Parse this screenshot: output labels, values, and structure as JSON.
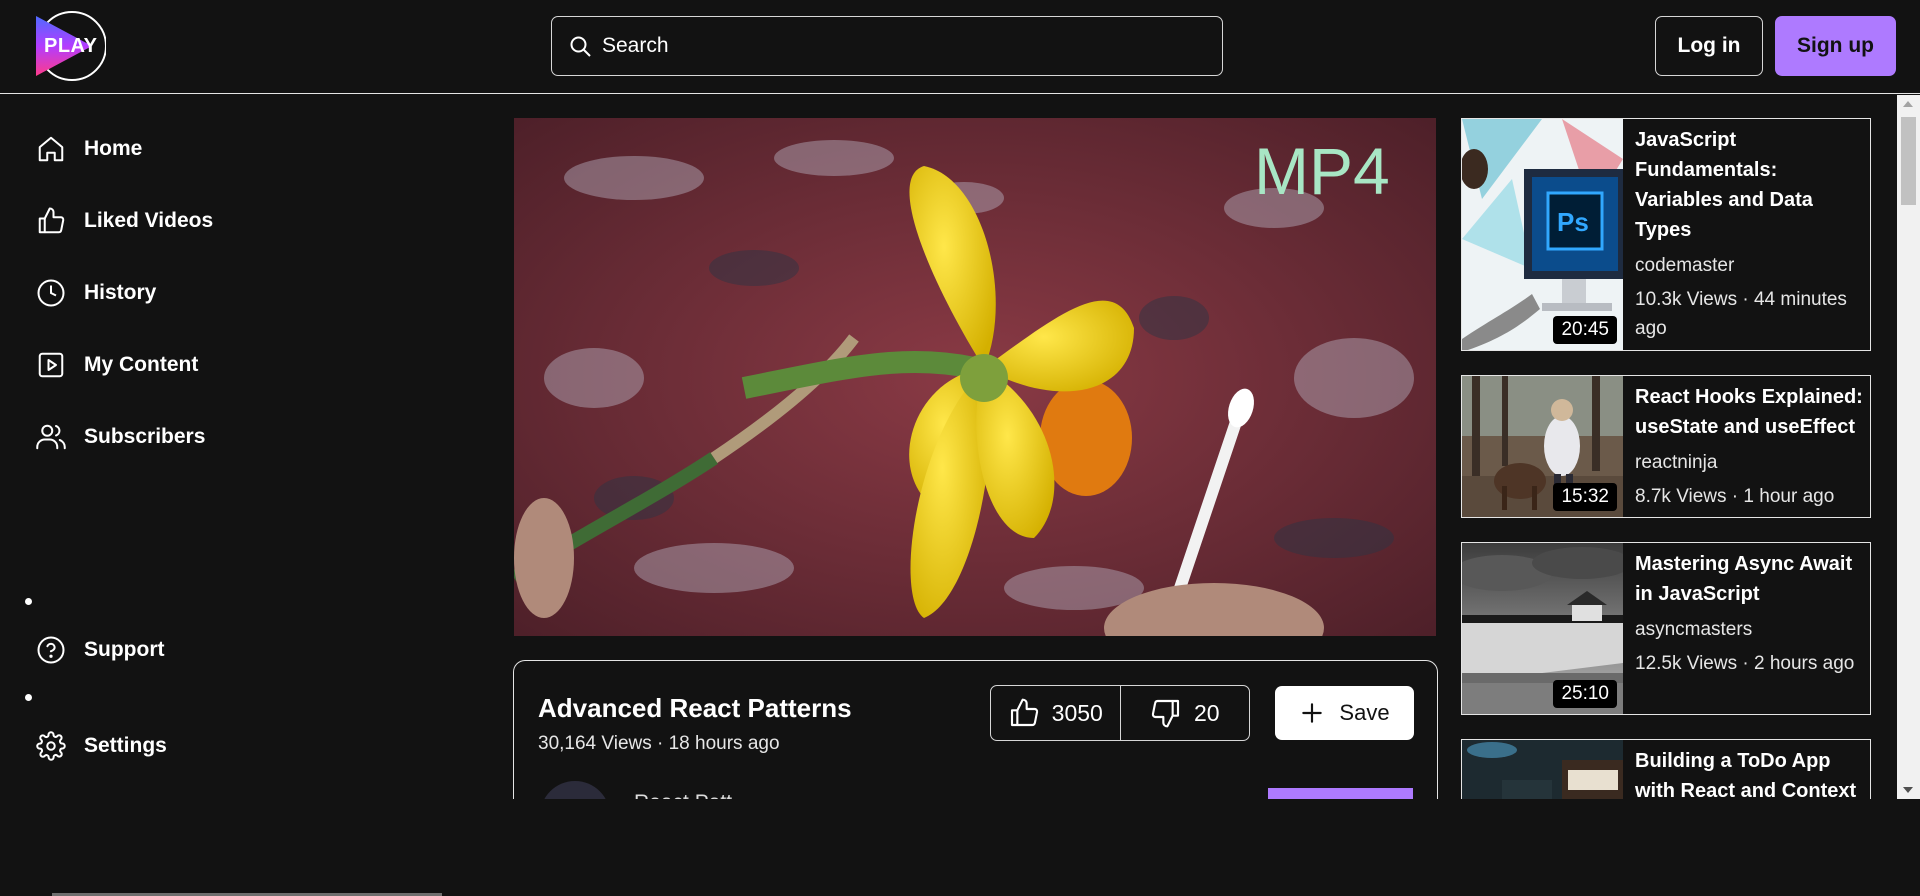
{
  "header": {
    "logo_text": "PLAY",
    "search_placeholder": "Search",
    "login_label": "Log in",
    "signup_label": "Sign up"
  },
  "sidebar": {
    "items": [
      {
        "label": "Home",
        "icon": "home-icon"
      },
      {
        "label": "Liked Videos",
        "icon": "thumbs-up-icon"
      },
      {
        "label": "History",
        "icon": "clock-icon"
      },
      {
        "label": "My Content",
        "icon": "play-square-icon"
      },
      {
        "label": "Subscribers",
        "icon": "users-icon"
      }
    ],
    "bottom_items": [
      {
        "label": "Support",
        "icon": "help-circle-icon"
      },
      {
        "label": "Settings",
        "icon": "gear-icon"
      }
    ]
  },
  "video": {
    "overlay_text": "MP4",
    "title": "Advanced React Patterns",
    "meta": "30,164 Views · 18 hours ago",
    "likes": "3050",
    "dislikes": "20",
    "save_label": "Save",
    "channel_name": "React Patt..."
  },
  "related": [
    {
      "title": "JavaScript Fundamentals: Variables and Data Types",
      "channel": "codemaster",
      "meta": "10.3k Views · 44 minutes ago",
      "duration": "20:45"
    },
    {
      "title": "React Hooks Explained: useState and useEffect",
      "channel": "reactninja",
      "meta": "8.7k Views · 1 hour ago",
      "duration": "15:32"
    },
    {
      "title": "Mastering Async Await in JavaScript",
      "channel": "asyncmasters",
      "meta": "12.5k Views · 2 hours ago",
      "duration": "25:10"
    },
    {
      "title": "Building a ToDo App with React and Context",
      "channel": "",
      "meta": "",
      "duration": ""
    }
  ],
  "colors": {
    "background": "#121212",
    "accent": "#ae7aff",
    "border": "#e5e5e5"
  }
}
